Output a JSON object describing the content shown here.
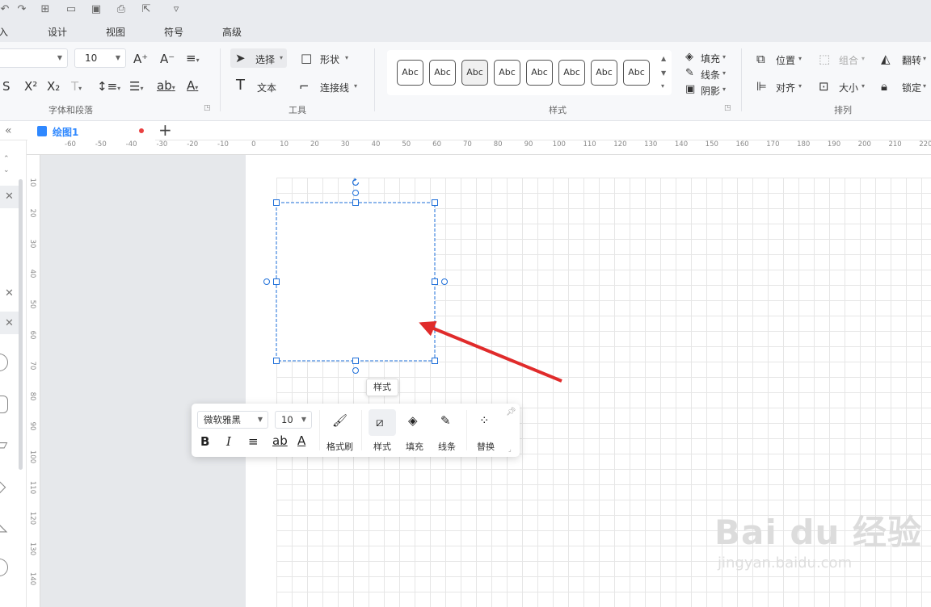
{
  "menu": {
    "items": [
      "入",
      "设计",
      "视图",
      "符号",
      "高级"
    ]
  },
  "ribbon": {
    "font_size_value": "10",
    "font_group_label": "字体和段落",
    "tools": {
      "select_label": "选择",
      "shape_label": "形状",
      "text_label": "文本",
      "connector_label": "连接线",
      "group_label": "工具"
    },
    "styles": {
      "swatch_label": "Abc",
      "group_label": "样式",
      "fill_label": "填充",
      "line_label": "线条",
      "shadow_label": "阴影"
    },
    "arrange": {
      "position_label": "位置",
      "combine_label": "组合",
      "flip_label": "翻转",
      "align_label": "对齐",
      "size_label": "大小",
      "lock_label": "锁定",
      "group_label": "排列"
    }
  },
  "tabs": {
    "document_name": "绘图1"
  },
  "ruler": {
    "h_ticks": [
      "-60",
      "-50",
      "-40",
      "-30",
      "-20",
      "-10",
      "0",
      "10",
      "20",
      "30",
      "40",
      "50",
      "60",
      "70",
      "80",
      "90",
      "100",
      "110",
      "120",
      "130",
      "140",
      "150",
      "160",
      "170",
      "180",
      "190",
      "200",
      "210",
      "220"
    ],
    "v_ticks": [
      "10",
      "20",
      "30",
      "40",
      "50",
      "60",
      "70",
      "80",
      "90",
      "100",
      "110",
      "120",
      "130",
      "140"
    ]
  },
  "tooltip": {
    "text": "样式"
  },
  "floating_toolbar": {
    "font_family": "微软雅黑",
    "font_size": "10",
    "bold_label": "B",
    "italic_label": "I",
    "format_painter_label": "格式刷",
    "style_label": "样式",
    "fill_label": "填充",
    "line_label": "线条",
    "replace_label": "替换"
  },
  "annotation": {
    "arrow_color": "#e02b2b"
  },
  "watermark": {
    "logo": "Bai du 经验",
    "url": "jingyan.baidu.com"
  },
  "colors": {
    "accent": "#2f88ff",
    "selection": "#1e6fd9"
  }
}
